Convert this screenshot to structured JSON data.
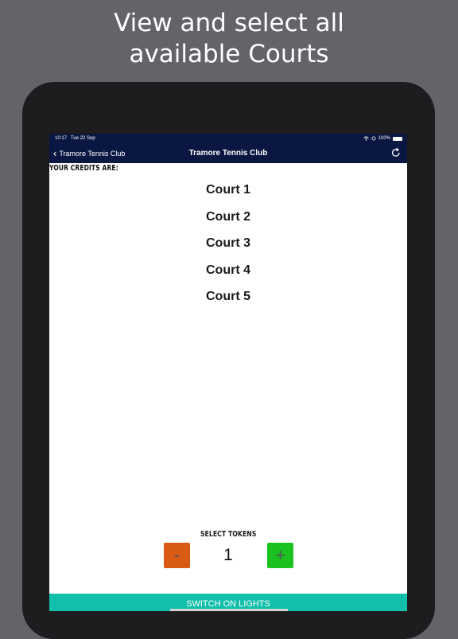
{
  "headline": {
    "line1": "View and select all",
    "line2": "available Courts"
  },
  "status_bar": {
    "time": "10:17",
    "date": "Tue 22 Sep",
    "battery": "100%"
  },
  "nav": {
    "back_label": "Tramore Tennis Club",
    "title": "Tramore Tennis Club"
  },
  "credits_label": "YOUR CREDITS ARE:",
  "courts": [
    "Court 1",
    "Court 2",
    "Court 3",
    "Court 4",
    "Court 5"
  ],
  "tokens": {
    "label": "SELECT TOKENS",
    "minus": "-",
    "plus": "+",
    "count": "1"
  },
  "lights_button": "SWITCH ON LIGHTS",
  "colors": {
    "background": "#636369",
    "navbar": "#0a1743",
    "minus_button": "#d95a12",
    "plus_button": "#19c21f",
    "lights_bar": "#12bfaa"
  }
}
